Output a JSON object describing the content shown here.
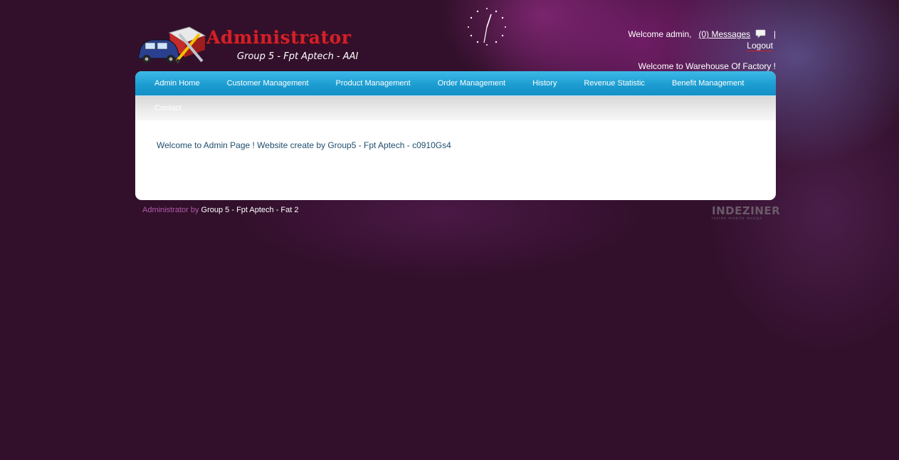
{
  "header": {
    "logo_title": "Administrator",
    "logo_subtitle": "Group 5 - Fpt Aptech - AAI"
  },
  "user_panel": {
    "welcome": "Welcome admin,",
    "messages_link": "(0) Messages",
    "separator": "|",
    "logout": "Logout",
    "site_welcome": "Welcome to Warehouse Of Factory !"
  },
  "nav": {
    "items": [
      {
        "label": "Admin Home"
      },
      {
        "label": "Customer Management"
      },
      {
        "label": "Product Management"
      },
      {
        "label": "Order Management"
      },
      {
        "label": "History"
      },
      {
        "label": "Revenue Statistic"
      },
      {
        "label": "Benefit Management"
      },
      {
        "label": "Contact"
      }
    ]
  },
  "main": {
    "welcome_text": "Welcome to Admin Page ! Website create by Group5 - Fpt Aptech - c0910Gs4"
  },
  "footer": {
    "lead": "Administrator by",
    "credit": "Group 5 - Fpt Aptech - Fat 2",
    "designer_logo": "INDEZINER",
    "designer_tagline": "inside mobile design"
  },
  "colors": {
    "page_background": "#32102b",
    "nav_blue": "#1a9bd0",
    "logo_red": "#d3202a",
    "content_text": "#1f4e6e",
    "footer_lead": "#b05aa8"
  }
}
